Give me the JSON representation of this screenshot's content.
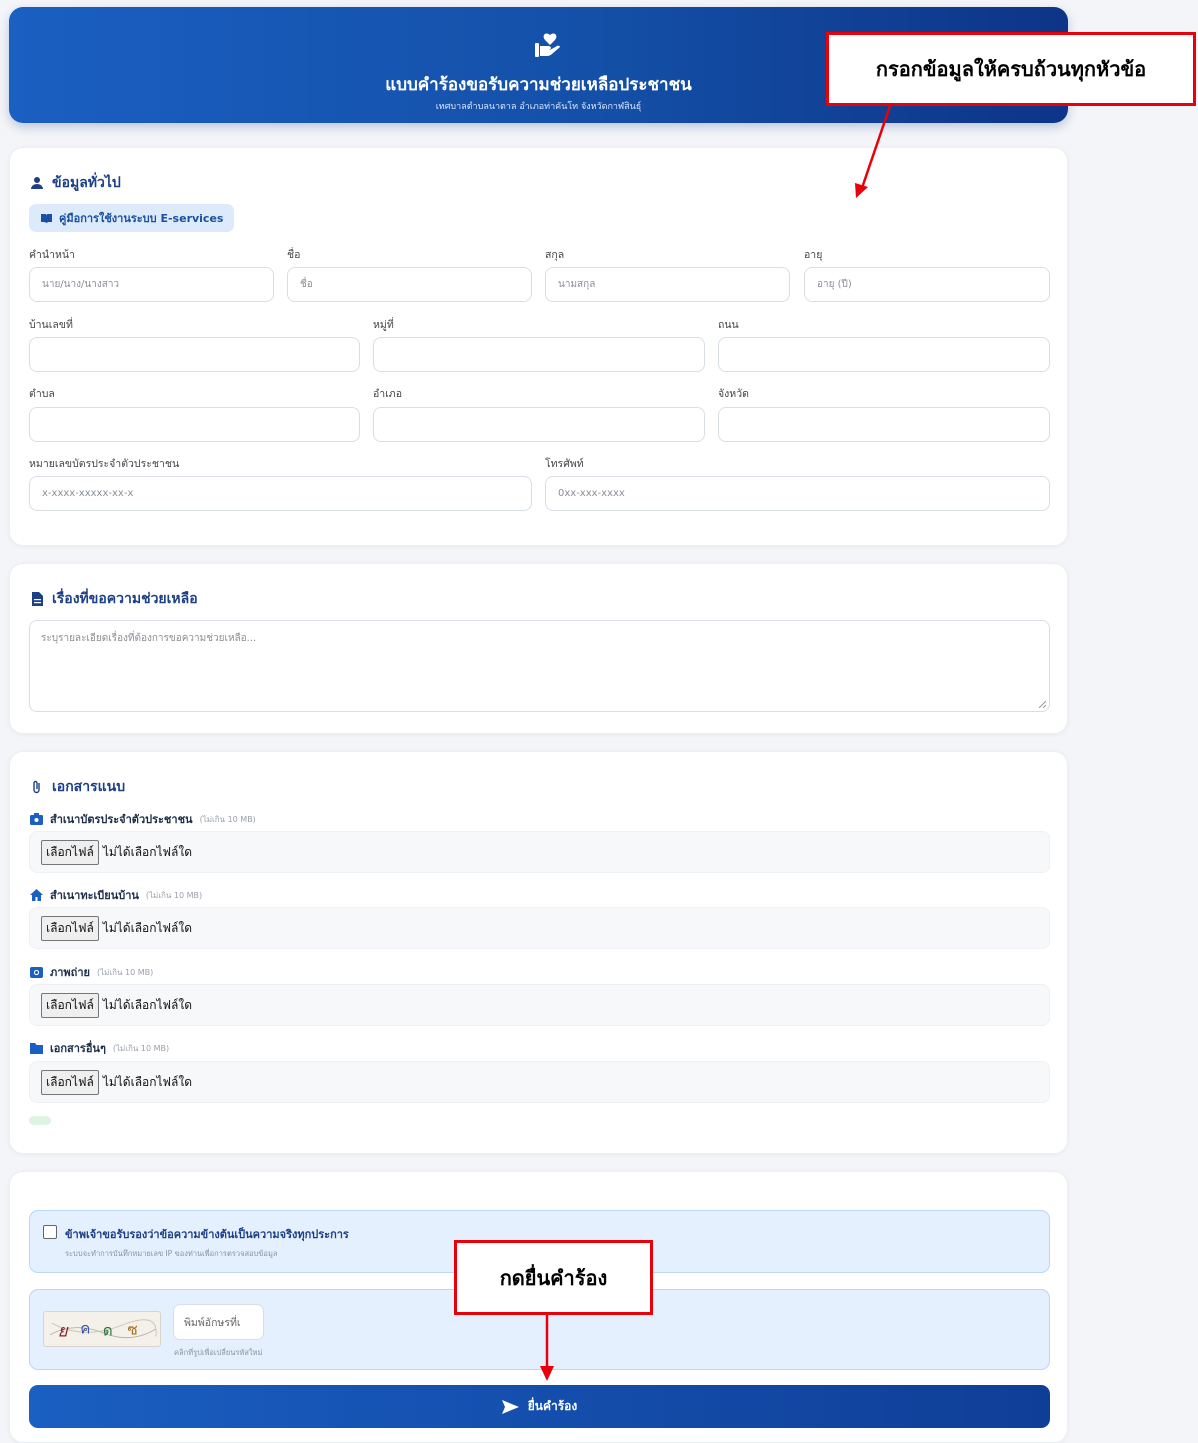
{
  "header": {
    "title": "แบบคำร้องขอรับความช่วยเหลือประชาชน",
    "subtitle": "เทศบาลตำบลนาตาล อำเภอท่าคันโท จังหวัดกาฬสินธุ์",
    "logo_icon": "hand-heart-icon"
  },
  "general": {
    "title": "ข้อมูลทั่วไป",
    "manual_label": "คู่มือการใช้งานระบบ E-services",
    "fields": {
      "prefix": {
        "label": "คำนำหน้า",
        "placeholder": "นาย/นาง/นางสาว"
      },
      "first_name": {
        "label": "ชื่อ",
        "placeholder": "ชื่อ"
      },
      "last_name": {
        "label": "สกุล",
        "placeholder": "นามสกุล"
      },
      "age": {
        "label": "อายุ",
        "placeholder": "อายุ (ปี)"
      },
      "house_no": {
        "label": "บ้านเลขที่",
        "placeholder": ""
      },
      "moo": {
        "label": "หมู่ที่",
        "placeholder": ""
      },
      "road": {
        "label": "ถนน",
        "placeholder": ""
      },
      "subdistrict": {
        "label": "ตำบล",
        "placeholder": ""
      },
      "district": {
        "label": "อำเภอ",
        "placeholder": ""
      },
      "province": {
        "label": "จังหวัด",
        "placeholder": ""
      },
      "id_card": {
        "label": "หมายเลขบัตรประจำตัวประชาชน",
        "placeholder": "x-xxxx-xxxxx-xx-x"
      },
      "phone": {
        "label": "โทรศัพท์",
        "placeholder": "0xx-xxx-xxxx"
      }
    }
  },
  "request": {
    "title": "เรื่องที่ขอความช่วยเหลือ",
    "placeholder": "ระบุรายละเอียดเรื่องที่ต้องการขอความช่วยเหลือ..."
  },
  "attachments": {
    "title": "เอกสารแนบ",
    "button_label": "เลือกไฟล์",
    "status_text": "ไม่ได้เลือกไฟล์ใด",
    "items": [
      {
        "label": "สำเนาบัตรประจำตัวประชาชน",
        "limit": "(ไม่เกิน 10 MB)",
        "icon": "id-card-icon"
      },
      {
        "label": "สำเนาทะเบียนบ้าน",
        "limit": "(ไม่เกิน 10 MB)",
        "icon": "house-icon"
      },
      {
        "label": "ภาพถ่าย",
        "limit": "(ไม่เกิน 10 MB)",
        "icon": "camera-icon"
      },
      {
        "label": "เอกสารอื่นๆ",
        "limit": "(ไม่เกิน 10 MB)",
        "icon": "folder-icon"
      }
    ]
  },
  "confirm": {
    "certify_label": "ข้าพเจ้าขอรับรองว่าข้อความข้างต้นเป็นความจริงทุกประการ",
    "certify_note": "ระบบจะทำการบันทึกหมายเลข IP ของท่านเพื่อการตรวจสอบข้อมูล",
    "captcha_placeholder": "พิมพ์อักษรที่เ",
    "captcha_note": "คลิกที่รูปเพื่อเปลี่ยนรหัสใหม่",
    "submit_label": "ยื่นคำร้อง"
  },
  "annotations": {
    "top_callout": "กรอกข้อมูลให้ครบถ้วนทุกหัวข้อ",
    "bottom_callout": "กดยื่นคำร้อง",
    "color": "#e8000a"
  },
  "colors": {
    "primary": "#1a5fc2",
    "dark": "#0d3487",
    "accent_bg": "#e4f0fd"
  }
}
